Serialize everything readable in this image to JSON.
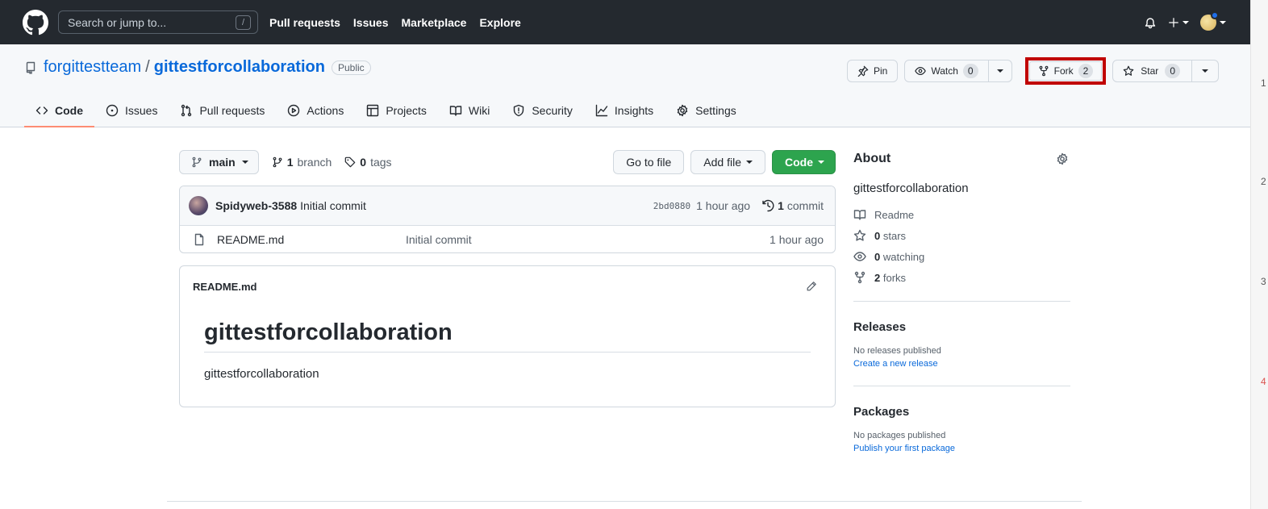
{
  "header": {
    "search_placeholder": "Search or jump to...",
    "search_shortcut": "/",
    "nav": [
      "Pull requests",
      "Issues",
      "Marketplace",
      "Explore"
    ]
  },
  "repo": {
    "owner": "forgittestteam",
    "separator": "/",
    "name": "gittestforcollaboration",
    "visibility": "Public",
    "actions": {
      "pin_label": "Pin",
      "watch_label": "Watch",
      "watch_count": "0",
      "fork_label": "Fork",
      "fork_count": "2",
      "star_label": "Star",
      "star_count": "0"
    },
    "tabs": [
      {
        "label": "Code",
        "icon": "code-icon",
        "active": true
      },
      {
        "label": "Issues",
        "icon": "issue-icon"
      },
      {
        "label": "Pull requests",
        "icon": "pull-request-icon"
      },
      {
        "label": "Actions",
        "icon": "play-icon"
      },
      {
        "label": "Projects",
        "icon": "table-icon"
      },
      {
        "label": "Wiki",
        "icon": "book-icon"
      },
      {
        "label": "Security",
        "icon": "shield-icon"
      },
      {
        "label": "Insights",
        "icon": "graph-icon"
      },
      {
        "label": "Settings",
        "icon": "gear-icon"
      }
    ]
  },
  "filebar": {
    "branch": "main",
    "branch_count": "1",
    "branch_label": "branch",
    "tag_count": "0",
    "tag_label": "tags",
    "go_to_file": "Go to file",
    "add_file": "Add file",
    "code": "Code"
  },
  "latest_commit": {
    "author": "Spidyweb-3588",
    "message": "Initial commit",
    "sha": "2bd0880",
    "age": "1 hour ago",
    "commit_count": "1",
    "commit_label": "commit"
  },
  "files": [
    {
      "name": "README.md",
      "message": "Initial commit",
      "age": "1 hour ago"
    }
  ],
  "readme": {
    "filename": "README.md",
    "heading": "gittestforcollaboration",
    "body": "gittestforcollaboration"
  },
  "about": {
    "title": "About",
    "description": "gittestforcollaboration",
    "readme_label": "Readme",
    "stars_count": "0",
    "stars_label": "stars",
    "watching_count": "0",
    "watching_label": "watching",
    "forks_count": "2",
    "forks_label": "forks"
  },
  "releases": {
    "title": "Releases",
    "empty": "No releases published",
    "link": "Create a new release"
  },
  "packages": {
    "title": "Packages",
    "empty": "No packages published",
    "link": "Publish your first package"
  },
  "gutter_numbers": [
    "1",
    "2",
    "3",
    "4"
  ],
  "colors": {
    "header_bg": "#24292f",
    "link": "#0969da",
    "primary_button": "#2da44e",
    "active_tab_underline": "#fd8c73",
    "fork_highlight": "#c00000"
  }
}
